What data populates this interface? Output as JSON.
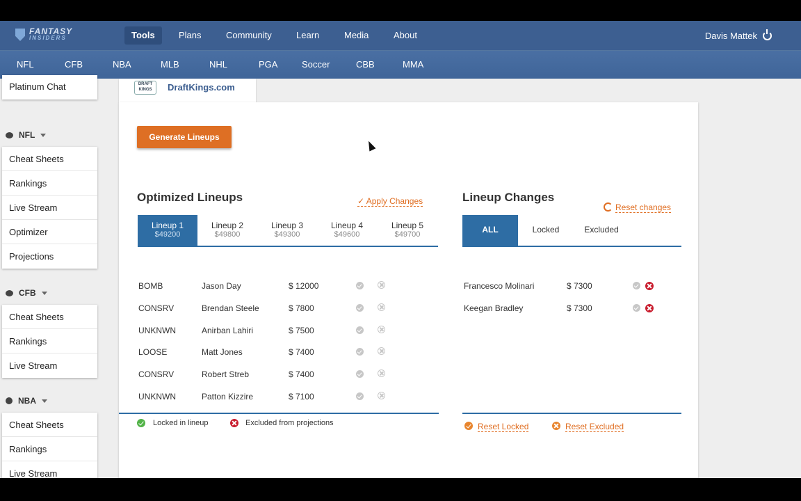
{
  "nav": {
    "logo_main": "FANTASY",
    "logo_sub": "INSIDERS",
    "items": [
      "Tools",
      "Plans",
      "Community",
      "Learn",
      "Media",
      "About"
    ],
    "active": "Tools",
    "user": "Davis Mattek"
  },
  "subnav": [
    "NFL",
    "CFB",
    "NBA",
    "MLB",
    "NHL",
    "PGA",
    "Soccer",
    "CBB",
    "MMA"
  ],
  "sidebar": {
    "top_item": "Platinum Chat",
    "sections": [
      {
        "sport": "NFL",
        "items": [
          "Cheat Sheets",
          "Rankings",
          "Live Stream",
          "Optimizer",
          "Projections"
        ]
      },
      {
        "sport": "CFB",
        "items": [
          "Cheat Sheets",
          "Rankings",
          "Live Stream"
        ]
      },
      {
        "sport": "NBA",
        "items": [
          "Cheat Sheets",
          "Rankings",
          "Live Stream"
        ]
      }
    ]
  },
  "site": {
    "logo_text": "DRAFT KINGS",
    "name": "DraftKings.com"
  },
  "generate_label": "Generate Lineups",
  "optimized": {
    "title": "Optimized Lineups",
    "apply": "✓ Apply Changes",
    "tabs": [
      {
        "label": "Lineup 1",
        "amount": "$49200"
      },
      {
        "label": "Lineup 2",
        "amount": "$49800"
      },
      {
        "label": "Lineup 3",
        "amount": "$49300"
      },
      {
        "label": "Lineup 4",
        "amount": "$49600"
      },
      {
        "label": "Lineup 5",
        "amount": "$49700"
      }
    ],
    "rows": [
      {
        "tag": "BOMB",
        "name": "Jason Day",
        "salary": "$ 12000"
      },
      {
        "tag": "CONSRV",
        "name": "Brendan Steele",
        "salary": "$ 7800"
      },
      {
        "tag": "UNKNWN",
        "name": "Anirban Lahiri",
        "salary": "$ 7500"
      },
      {
        "tag": "LOOSE",
        "name": "Matt Jones",
        "salary": "$ 7400"
      },
      {
        "tag": "CONSRV",
        "name": "Robert Streb",
        "salary": "$ 7400"
      },
      {
        "tag": "UNKNWN",
        "name": "Patton Kizzire",
        "salary": "$ 7100"
      }
    ],
    "legend_locked": "Locked in lineup",
    "legend_excluded": "Excluded from projections"
  },
  "changes": {
    "title": "Lineup Changes",
    "reset": "Reset changes",
    "tabs": [
      "ALL",
      "Locked",
      "Excluded"
    ],
    "rows": [
      {
        "name": "Francesco Molinari",
        "salary": "$ 7300"
      },
      {
        "name": "Keegan Bradley",
        "salary": "$ 7300"
      }
    ],
    "reset_locked": "Reset Locked",
    "reset_excluded": "Reset Excluded"
  },
  "colors": {
    "nav": "#3d5f91",
    "accent": "#de6f24",
    "tab_active": "#2e6da4",
    "excluded": "#c91d2e",
    "locked": "#52b348"
  }
}
